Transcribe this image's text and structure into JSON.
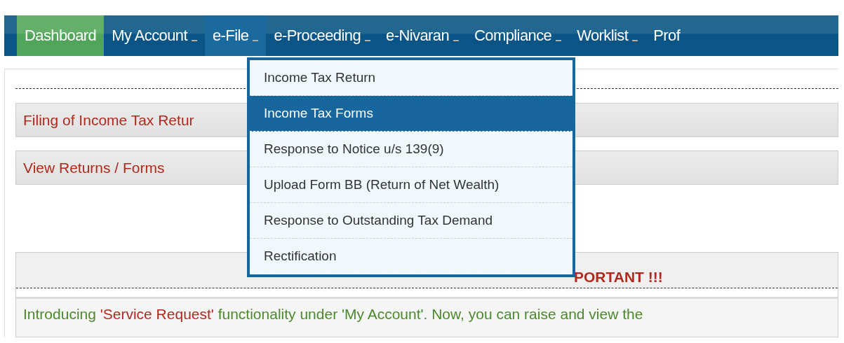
{
  "nav": [
    {
      "label": "Dashboard",
      "kind": "home",
      "selected": false
    },
    {
      "label": "My Account",
      "kind": "menu",
      "selected": false
    },
    {
      "label": "e-File",
      "kind": "menu",
      "selected": true
    },
    {
      "label": "e-Proceeding",
      "kind": "menu",
      "selected": false
    },
    {
      "label": "e-Nivaran",
      "kind": "menu",
      "selected": false
    },
    {
      "label": "Compliance",
      "kind": "menu",
      "selected": false
    },
    {
      "label": "Worklist",
      "kind": "menu",
      "selected": false
    },
    {
      "label": "Prof",
      "kind": "plain",
      "selected": false
    }
  ],
  "dropdown": [
    {
      "label": "Income Tax Return",
      "selected": false
    },
    {
      "label": "Income Tax Forms",
      "selected": true
    },
    {
      "label": "Response to Notice u/s 139(9)",
      "selected": false
    },
    {
      "label": "Upload Form BB (Return of Net Wealth)",
      "selected": false
    },
    {
      "label": "Response to Outstanding Tax Demand",
      "selected": false
    },
    {
      "label": "Rectification",
      "selected": false
    }
  ],
  "sections": [
    "Filing of Income Tax Retur",
    "View Returns / Forms"
  ],
  "notice": {
    "title": "PORTANT !!!",
    "parts": [
      {
        "text": "Introducing ",
        "kind": "plain"
      },
      {
        "text": "'Service Request'",
        "kind": "highlight"
      },
      {
        "text": " functionality under 'My Account'. Now, you can raise and view the",
        "kind": "plain"
      }
    ]
  }
}
